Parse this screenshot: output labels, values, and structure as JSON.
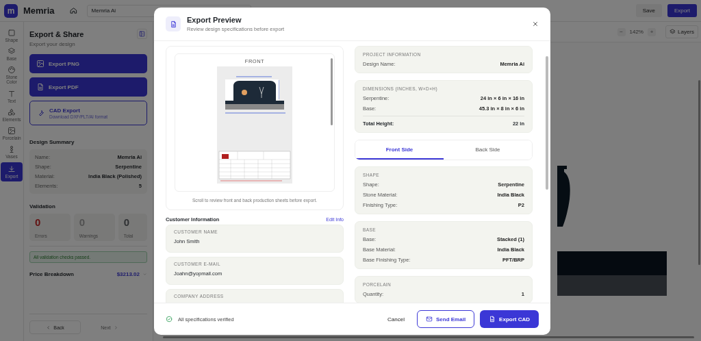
{
  "app_bar": {
    "logo": "m",
    "app_name": "Memria",
    "project_name": "Memria Ai",
    "actions": [
      {
        "label": "Save",
        "kind": "secondary"
      },
      {
        "label": "Export",
        "kind": "primary"
      }
    ]
  },
  "tool_rail": [
    {
      "label": "Shape",
      "selected": false
    },
    {
      "label": "Base",
      "selected": false
    },
    {
      "label": "Stone Color",
      "selected": false
    },
    {
      "label": "Text",
      "selected": false
    },
    {
      "label": "Elements",
      "selected": false
    },
    {
      "label": "Porcelain",
      "selected": false
    },
    {
      "label": "Vases",
      "selected": false
    },
    {
      "label": "Export",
      "selected": true
    }
  ],
  "side_panel": {
    "title": "Export & Share",
    "subtitle": "Export your design",
    "export_options": [
      {
        "label": "Export PNG",
        "kind": "filled"
      },
      {
        "label": "Export PDF",
        "kind": "filled"
      },
      {
        "label": "CAD Export",
        "sublabel": "Download DXF/PLT/AI format",
        "kind": "outlined"
      }
    ],
    "summary_title": "Design Summary",
    "summary": [
      {
        "label": "Name:",
        "value": "Memria Ai"
      },
      {
        "label": "Shape:",
        "value": "Serpentine"
      },
      {
        "label": "Material:",
        "value": "India Black (Polished)"
      },
      {
        "label": "Elements:",
        "value": "5"
      }
    ],
    "validation_title": "Validation",
    "validation": [
      {
        "count": "0",
        "label": "Errors",
        "kind": "error"
      },
      {
        "count": "0",
        "label": "Warnings",
        "kind": "warning"
      },
      {
        "count": "0",
        "label": "Total",
        "kind": "total"
      }
    ],
    "validation_message": "All validation checks passed.",
    "price": {
      "label": "Price Breakdown",
      "value": "$3213.02"
    },
    "nav": [
      {
        "label": "Back",
        "disabled": false
      },
      {
        "label": "Next",
        "disabled": true
      }
    ]
  },
  "canvas_toolbar": {
    "zoom_out": "−",
    "zoom": "142%",
    "zoom_in": "+",
    "layers": "Layers"
  },
  "modal": {
    "title": "Export Preview",
    "subtitle": "Review design specifications before export",
    "preview": {
      "sheet_label": "FRONT",
      "caption": "Scroll to review front and back production sheets before export."
    },
    "customer": {
      "title": "Customer Information",
      "edit_link": "Edit Info",
      "fields": [
        {
          "label": "CUSTOMER NAME",
          "value": "John Smith"
        },
        {
          "label": "CUSTOMER E-MAIL",
          "value": "Joahn@yopmail.com"
        },
        {
          "label": "COMPANY ADDRESS"
        }
      ]
    },
    "info_sections": [
      {
        "title": "PROJECT INFORMATION",
        "rows": [
          {
            "label": "Design Name:",
            "value": "Memria Ai"
          }
        ]
      },
      {
        "title": "DIMENSIONS (INCHES, W×D×H)",
        "rows": [
          {
            "label": "Serpentine:",
            "value": "24 in × 6 in × 16 in"
          },
          {
            "label": "Base:",
            "value": "45.3 in × 8 in × 6 in"
          }
        ],
        "total": {
          "label": "Total Height:",
          "value": "22 in"
        }
      }
    ],
    "side_tabs": [
      {
        "label": "Front Side",
        "selected": true
      },
      {
        "label": "Back Side",
        "selected": false
      }
    ],
    "side_sections": [
      {
        "title": "SHAPE",
        "rows": [
          {
            "label": "Shape:",
            "value": "Serpentine"
          },
          {
            "label": "Stone Material:",
            "value": "India Black"
          },
          {
            "label": "Finishing Type:",
            "value": "P2"
          }
        ]
      },
      {
        "title": "BASE",
        "rows": [
          {
            "label": "Base:",
            "value": "Stacked (1)"
          },
          {
            "label": "Base Material:",
            "value": "India Black"
          },
          {
            "label": "Base Finishing Type:",
            "value": "PFT/BRP"
          }
        ]
      },
      {
        "title": "PORCELAIN",
        "rows": [
          {
            "label": "Quantity:",
            "value": "1"
          }
        ]
      }
    ],
    "footer": {
      "status": "All specifications verified",
      "cancel": "Cancel",
      "send_email": "Send Email",
      "export_cad": "Export CAD"
    }
  }
}
